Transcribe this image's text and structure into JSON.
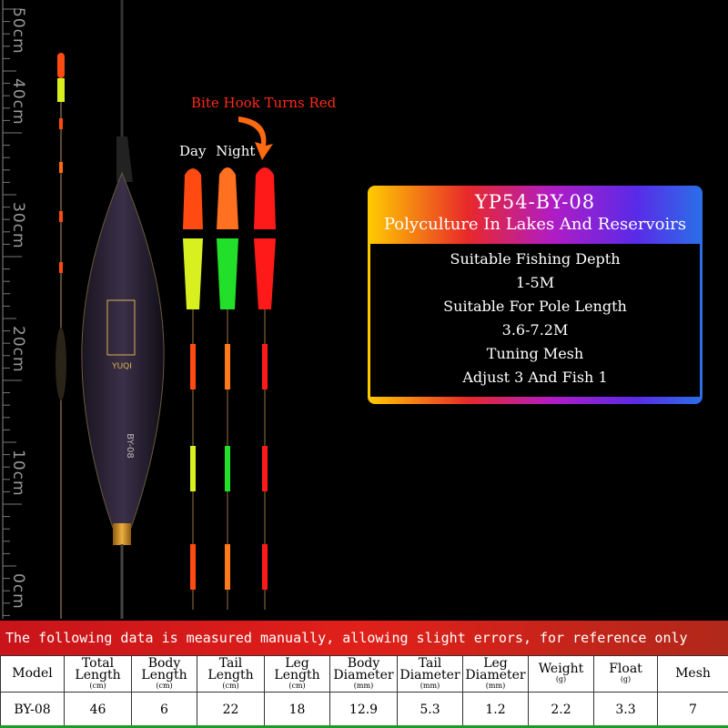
{
  "ruler": {
    "labels": [
      "50cm",
      "40cm",
      "30cm",
      "20cm",
      "10cm",
      "0cm"
    ]
  },
  "callouts": {
    "bite": "Bite Hook Turns Red",
    "day": "Day",
    "night": "Night"
  },
  "info": {
    "model": "YP54-BY-08",
    "subtitle": "Polyculture In Lakes And Reservoirs",
    "lines": [
      "Suitable Fishing Depth",
      "1-5M",
      "Suitable For Pole Length",
      "3.6-7.2M",
      "Tuning Mesh",
      "Adjust 3 And Fish 1"
    ]
  },
  "float_body_text": {
    "brand": "YUQI",
    "model": "BY-08"
  },
  "note": "The following data is measured manually, allowing slight errors, for reference only",
  "table": {
    "headers": [
      {
        "label": "Model",
        "unit": ""
      },
      {
        "label": "Total Length",
        "unit": "(cm)"
      },
      {
        "label": "Body Length",
        "unit": "(cm)"
      },
      {
        "label": "Tail Length",
        "unit": "(cm)"
      },
      {
        "label": "Leg Length",
        "unit": "(cm)"
      },
      {
        "label": "Body Diameter",
        "unit": "(mm)"
      },
      {
        "label": "Tail Diameter",
        "unit": "(mm)"
      },
      {
        "label": "Leg Diameter",
        "unit": "(mm)"
      },
      {
        "label": "Weight",
        "unit": "(g)"
      },
      {
        "label": "Float",
        "unit": "(g)"
      },
      {
        "label": "Mesh",
        "unit": ""
      }
    ],
    "row": [
      "BY-08",
      "46",
      "6",
      "22",
      "18",
      "12.9",
      "5.3",
      "1.2",
      "2.2",
      "3.3",
      "7"
    ]
  },
  "colors": {
    "tip_orange": "#ff4a12",
    "tip_yellow": "#d8f020",
    "tip_green": "#22e02a",
    "tip_red": "#ff1a1a",
    "note_red": "#d81e1a",
    "panel_accent": "#b11cc4"
  }
}
